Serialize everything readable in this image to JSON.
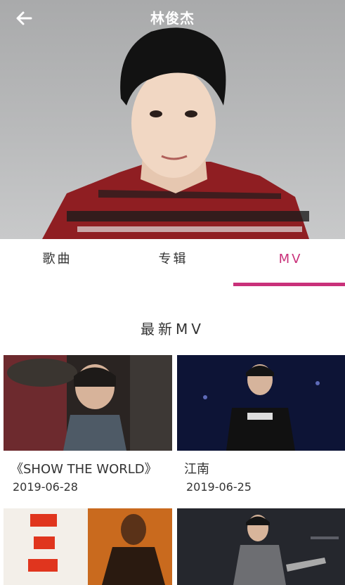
{
  "header": {
    "title": "林俊杰",
    "back_icon": "arrow-left-icon"
  },
  "tabs": [
    {
      "label": "歌曲",
      "active": false
    },
    {
      "label": "专辑",
      "active": false
    },
    {
      "label": "MV",
      "active": true
    }
  ],
  "colors": {
    "accent": "#c9317a"
  },
  "section": {
    "title": "最新MV"
  },
  "mvs": [
    {
      "title": "《SHOW THE WORLD》",
      "date": "2019-06-28"
    },
    {
      "title": "江南",
      "date": "2019-06-25"
    },
    {
      "title": "",
      "date": ""
    },
    {
      "title": "",
      "date": ""
    }
  ]
}
